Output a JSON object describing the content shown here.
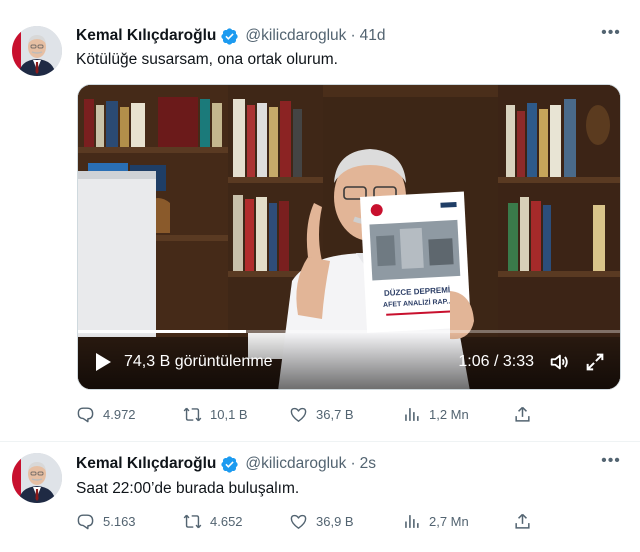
{
  "tweets": [
    {
      "author": "Kemal Kılıçdaroğlu",
      "handle": "@kilicdarogluk",
      "separator": "·",
      "age": "41d",
      "text": "Kötülüğe susarsam, ona ortak olurum.",
      "video": {
        "views_label": "74,3 B görüntülenme",
        "time_label": "1:06 / 3:33",
        "progress": 0.31,
        "report_title": "DÜZCE DEPREMİ",
        "report_subtitle": "AFET ANALİZİ RAP..."
      },
      "stats": {
        "replies": "4.972",
        "retweets": "10,1 B",
        "likes": "36,7 B",
        "views": "1,2 Mn"
      }
    },
    {
      "author": "Kemal Kılıçdaroğlu",
      "handle": "@kilicdarogluk",
      "separator": "·",
      "age": "2s",
      "text": "Saat 22:00’de burada buluşalım.",
      "stats": {
        "replies": "5.163",
        "retweets": "4.652",
        "likes": "36,9 B",
        "views": "2,7 Mn"
      }
    }
  ],
  "icons": {
    "verified": "verified-badge-icon",
    "more": "more-options-icon",
    "reply": "reply-icon",
    "retweet": "retweet-icon",
    "like": "heart-icon",
    "views": "analytics-bars-icon",
    "share": "share-icon",
    "play": "play-icon",
    "volume": "volume-icon",
    "fullscreen": "fullscreen-icon"
  },
  "colors": {
    "verified": "#1d9bf0",
    "muted": "#536471",
    "text": "#0f1419",
    "border": "#eff3f4"
  }
}
